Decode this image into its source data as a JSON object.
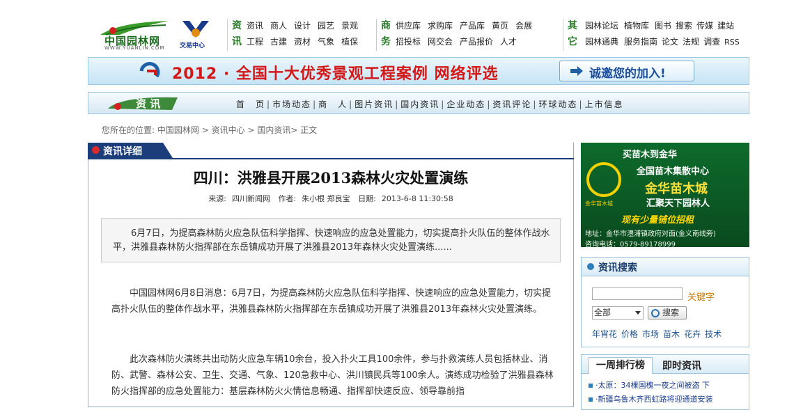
{
  "logo": {
    "brand": "中国园林网",
    "url": "WWW.YUANLIN.COM"
  },
  "logo2": {
    "text": "交易中心"
  },
  "nav": {
    "group1": {
      "cat1": "资",
      "cat2": "讯",
      "row1": [
        "资讯",
        "商人",
        "设计",
        "园艺",
        "景观"
      ],
      "row2": [
        "工程",
        "古建",
        "资材",
        "气象",
        "植保"
      ]
    },
    "group2": {
      "cat1": "商",
      "cat2": "务",
      "row1": [
        "供应库",
        "求购库",
        "产品库",
        "黄页",
        "会展"
      ],
      "row2": [
        "招投标",
        "网交会",
        "产品报价",
        "人才"
      ]
    },
    "group3": {
      "cat1": "其",
      "cat2": "它",
      "row1": [
        "园林论坛",
        "植物库",
        "图书",
        "搜索",
        "传媒",
        "建站"
      ],
      "row2": [
        "园林通典",
        "服务指南",
        "论文",
        "法规",
        "调查",
        "RSS"
      ]
    }
  },
  "banner": {
    "title": "2012 · 全国十大优秀景观工程案例 网络评选",
    "join": "诚邀您的加入!"
  },
  "section": {
    "tag": "资 讯",
    "links": [
      "首　页",
      "市场动态",
      "商　人",
      "图片资讯",
      "国内资讯",
      "企业动态",
      "资讯评论",
      "环球动态",
      "上市信息"
    ]
  },
  "breadcrumb": {
    "prefix": "您所在的位置:",
    "items": [
      "中国园林网",
      "资讯中心",
      "国内资讯",
      "正文"
    ],
    "sep": ">"
  },
  "article": {
    "tab": "资讯详细",
    "title": "四川：洪雅县开展2013森林火灾处置演练",
    "meta": {
      "source_label": "来源:",
      "source": "四川新闻网",
      "author_label": "作者:",
      "author": "朱小根 郑良宝",
      "date_label": "日期:",
      "date": "2013-6-8 11:30:58"
    },
    "summary": "6月7日，为提高森林防火应急队伍科学指挥、快速响应的应急处置能力，切实提高扑火队伍的整体作战水平，洪雅县森林防火指挥部在东岳镇成功开展了洪雅县2013年森林火灾处置演练......",
    "p1": "中国园林网6月8日消息：6月7日，为提高森林防火应急队伍科学指挥、快速响应的应急处置能力，切实提高扑火队伍的整体作战水平，洪雅县森林防火指挥部在东岳镇成功开展了洪雅县2013年森林火灾处置演练。",
    "p2": "此次森林防火演练共出动防火应急车辆10余台，投入扑火工具100余件，参与扑救演练人员包括林业、消防、武警、森林公安、卫生、交通、气象、120急救中心、洪川镇民兵等100余人。演练成功检验了洪雅县森林防火指挥部的应急处置能力：基层森林防火火情信息畅通、指挥部快速反应、领导靠前指"
  },
  "ad": {
    "l1": "买苗木到金华",
    "l2": "全国苗木集散中心",
    "l3": "金华苗木城",
    "l4": "汇聚天下园林人",
    "l5": "现有少量铺位招租",
    "l6": "地址：金华市澧浦镇政府对面(金义南线旁)",
    "l7": "咨询电话：0579-89178999",
    "clabel": "金华苗木城"
  },
  "search": {
    "title": "资讯搜索",
    "keyword_label": "关键字",
    "select_value": "全部",
    "button": "搜索",
    "tags": [
      "年宵花",
      "价格",
      "市场",
      "苗木",
      "花卉",
      "技术"
    ]
  },
  "rank": {
    "tab1": "一周排行榜",
    "tab2": "即时资讯",
    "items": [
      "·太原：34棵国槐一夜之间被盗 下",
      "·新疆乌鲁木齐西虹路将迎通道安装"
    ]
  },
  "colors": {
    "green": "#2a7a2a",
    "red": "#d41818",
    "navy": "#1b3d7a"
  }
}
